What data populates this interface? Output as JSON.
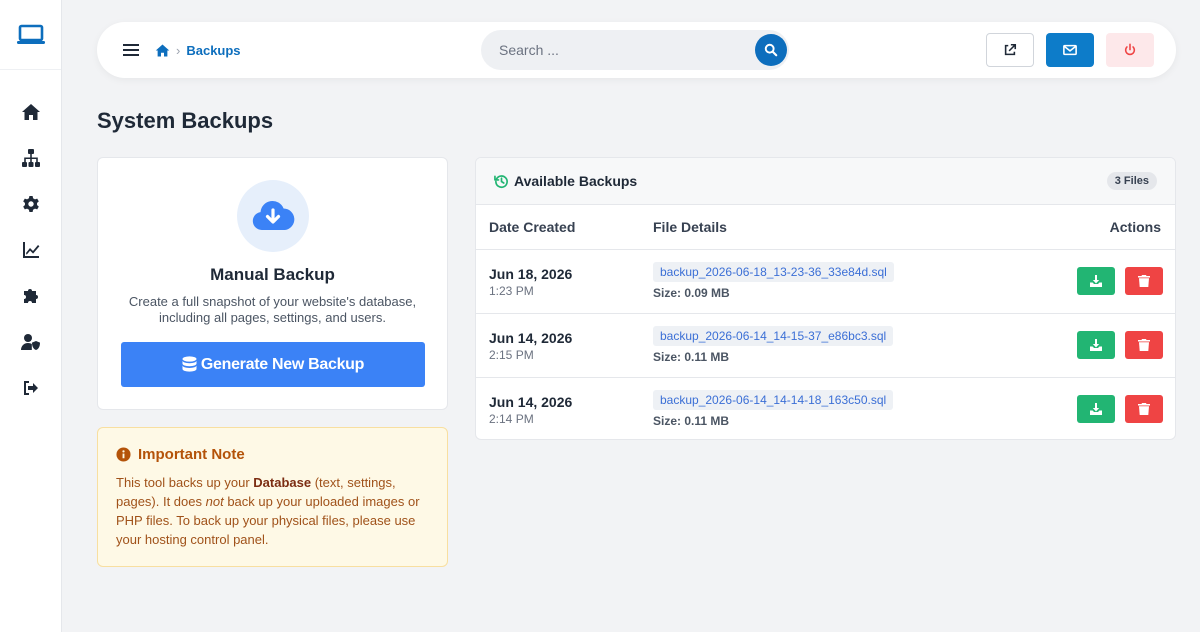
{
  "header": {
    "breadcrumb": "Backups",
    "breadcrumb_sep": "›",
    "search_placeholder": "Search ..."
  },
  "page": {
    "title": "System Backups"
  },
  "manual": {
    "title": "Manual Backup",
    "description": "Create a full snapshot of your website's database, including all pages, settings, and users.",
    "button_label": "Generate New Backup"
  },
  "note": {
    "title": "Important Note",
    "p1": "This tool backs up your ",
    "bold": "Database",
    "p2": " (text, settings, pages). It does ",
    "em": "not",
    "p3": " back up your uploaded images or PHP files. To back up your physical files, please use your hosting control panel."
  },
  "backups": {
    "title": "Available Backups",
    "badge": "3 Files",
    "columns": {
      "date": "Date Created",
      "file": "File Details",
      "actions": "Actions"
    },
    "rows": [
      {
        "date": "Jun 18, 2026",
        "time": "1:23 PM",
        "file": "backup_2026-06-18_13-23-36_33e84d.sql",
        "size": "Size: 0.09 MB"
      },
      {
        "date": "Jun 14, 2026",
        "time": "2:15 PM",
        "file": "backup_2026-06-14_14-15-37_e86bc3.sql",
        "size": "Size: 0.11 MB"
      },
      {
        "date": "Jun 14, 2026",
        "time": "2:14 PM",
        "file": "backup_2026-06-14_14-14-18_163c50.sql",
        "size": "Size: 0.11 MB"
      }
    ]
  },
  "icons": {
    "sidebar": [
      "laptop-icon",
      "home-icon",
      "sitemap-icon",
      "gear-icon",
      "chart-line-icon",
      "puzzle-icon",
      "user-shield-icon",
      "sign-out-icon"
    ],
    "toolbar": [
      "external-link-icon",
      "envelope-icon",
      "power-icon"
    ]
  },
  "colors": {
    "primary": "#0d6ebd",
    "button_blue": "#3b82f6",
    "success": "#22b573",
    "danger": "#ef4444",
    "note_bg": "#fef9e6",
    "note_text": "#b45309"
  }
}
